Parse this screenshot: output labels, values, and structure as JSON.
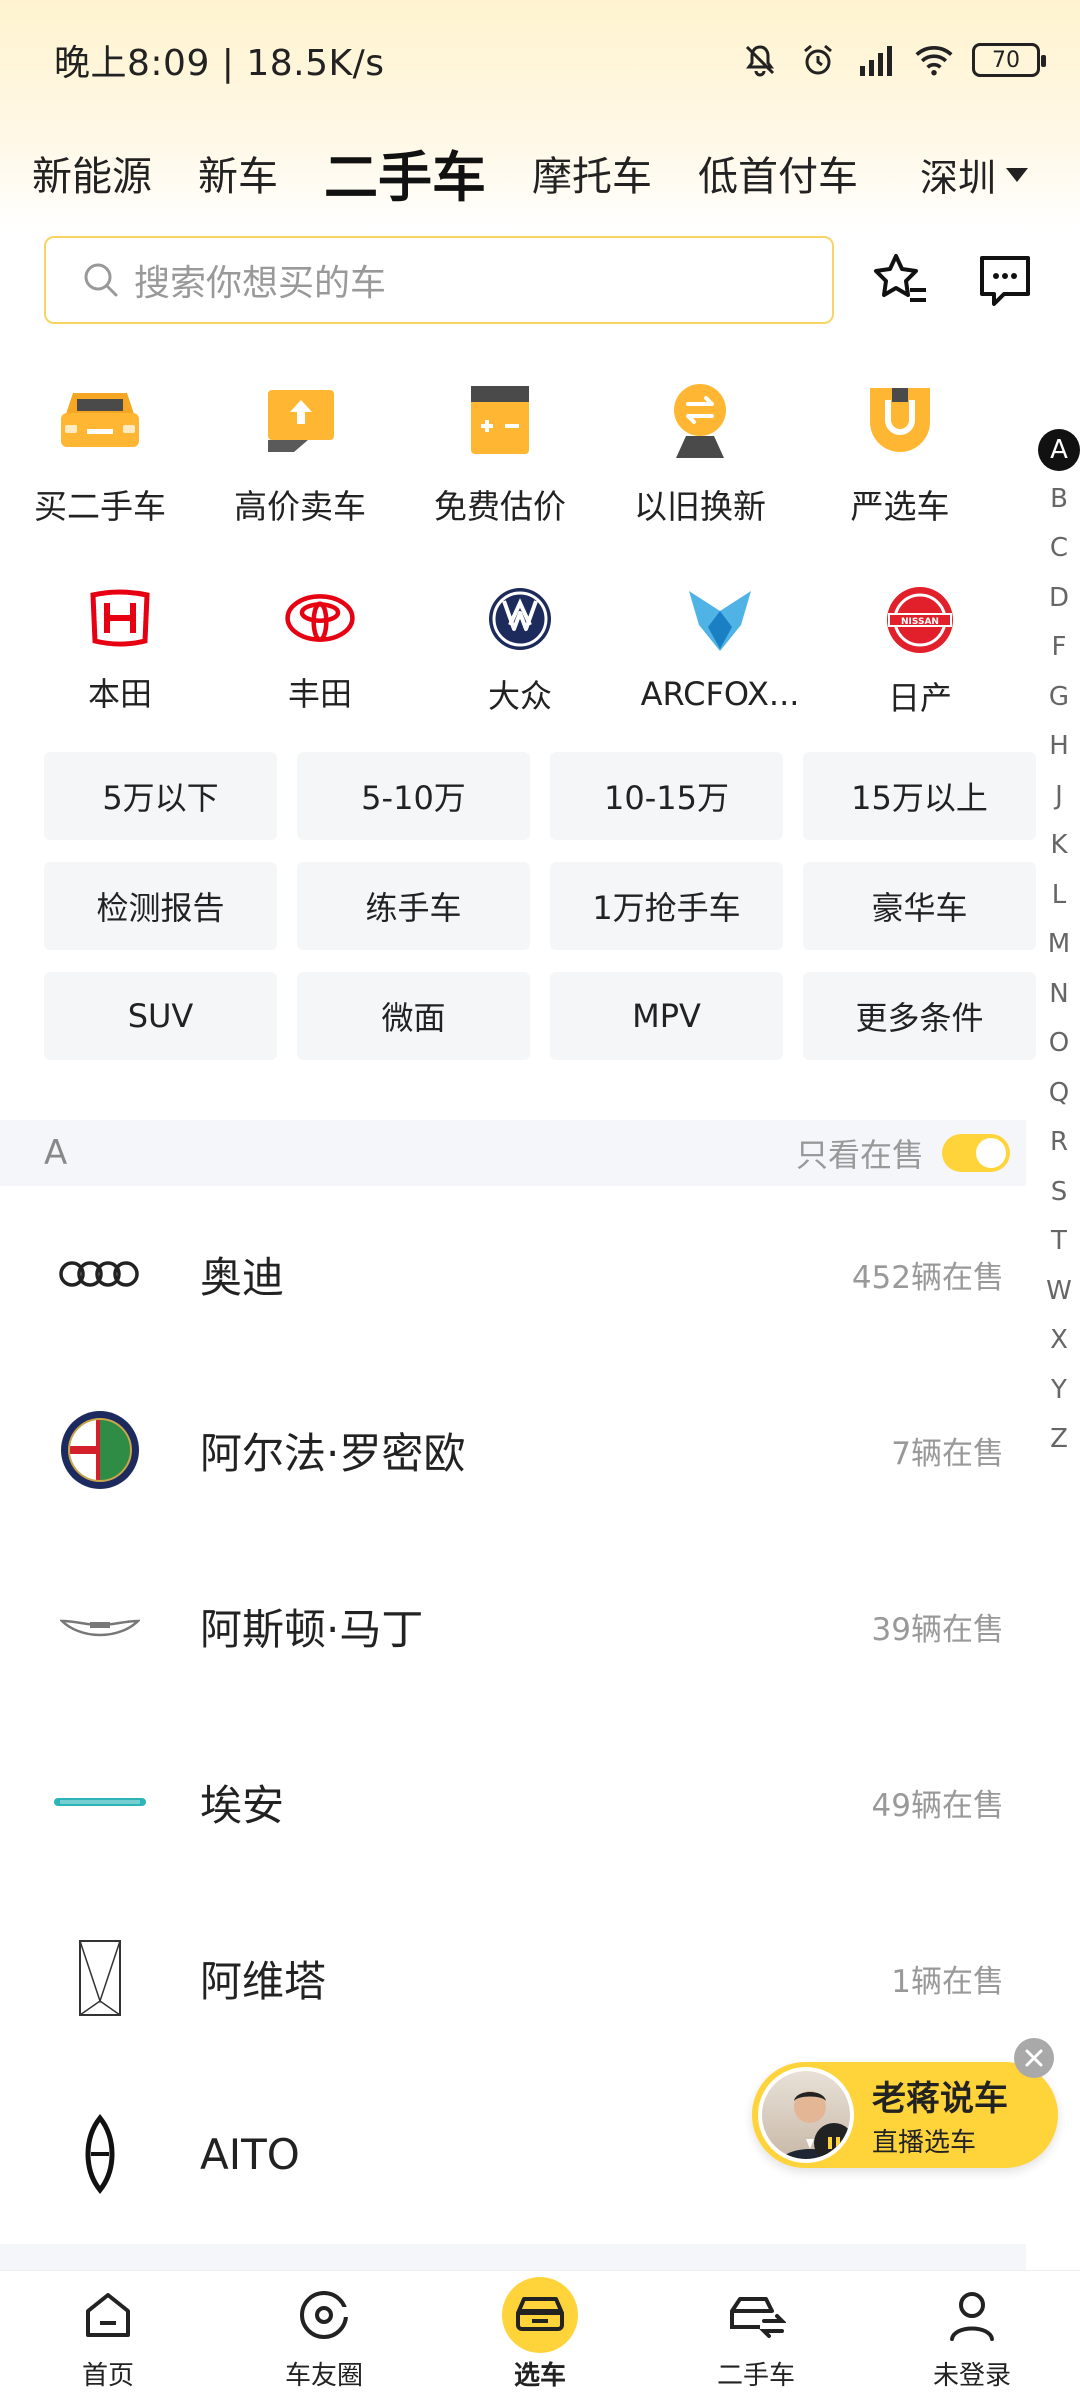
{
  "status": {
    "time_speed": "晚上8:09 | 18.5K/s",
    "battery": "70"
  },
  "tabs": [
    "新能源",
    "新车",
    "二手车",
    "摩托车",
    "低首付车"
  ],
  "city": "深圳",
  "search": {
    "placeholder": "搜索你想买的车"
  },
  "services": [
    {
      "label": "买二手车",
      "icon": "car-front-icon"
    },
    {
      "label": "高价卖车",
      "icon": "sell-upload-icon"
    },
    {
      "label": "免费估价",
      "icon": "calculator-icon"
    },
    {
      "label": "以旧换新",
      "icon": "exchange-icon"
    },
    {
      "label": "严选车",
      "icon": "shield-badge-icon"
    }
  ],
  "brands": [
    {
      "label": "本田",
      "icon": "honda-logo"
    },
    {
      "label": "丰田",
      "icon": "toyota-logo"
    },
    {
      "label": "大众",
      "icon": "volkswagen-logo"
    },
    {
      "label": "ARCFOX...",
      "icon": "arcfox-logo"
    },
    {
      "label": "日产",
      "icon": "nissan-logo"
    }
  ],
  "filters": [
    "5万以下",
    "5-10万",
    "10-15万",
    "15万以上",
    "检测报告",
    "练手车",
    "1万抢手车",
    "豪华车",
    "SUV",
    "微面",
    "MPV",
    "更多条件"
  ],
  "alpha_index": [
    "A",
    "B",
    "C",
    "D",
    "F",
    "G",
    "H",
    "J",
    "K",
    "L",
    "M",
    "N",
    "O",
    "Q",
    "R",
    "S",
    "T",
    "W",
    "X",
    "Y",
    "Z"
  ],
  "section": {
    "letter": "A",
    "onsale_label": "只看在售",
    "onsale_on": true
  },
  "cars": [
    {
      "name": "奥迪",
      "count": "452辆在售",
      "icon": "audi-logo"
    },
    {
      "name": "阿尔法·罗密欧",
      "count": "7辆在售",
      "icon": "alfa-romeo-logo"
    },
    {
      "name": "阿斯顿·马丁",
      "count": "39辆在售",
      "icon": "aston-martin-logo"
    },
    {
      "name": "埃安",
      "count": "49辆在售",
      "icon": "aion-logo"
    },
    {
      "name": "阿维塔",
      "count": "1辆在售",
      "icon": "avatr-logo"
    },
    {
      "name": "AITO",
      "count": "",
      "icon": "aito-logo"
    }
  ],
  "live": {
    "title": "老蒋说车",
    "subtitle": "直播选车"
  },
  "bottom_nav": [
    {
      "label": "首页",
      "icon": "home-icon"
    },
    {
      "label": "车友圈",
      "icon": "circle-icon"
    },
    {
      "label": "选车",
      "icon": "car-select-icon"
    },
    {
      "label": "二手车",
      "icon": "used-car-icon"
    },
    {
      "label": "未登录",
      "icon": "user-icon"
    }
  ],
  "colors": {
    "accent": "#ffd43b",
    "accent_dark": "#f5a623",
    "chip_bg": "#f5f6f8"
  }
}
